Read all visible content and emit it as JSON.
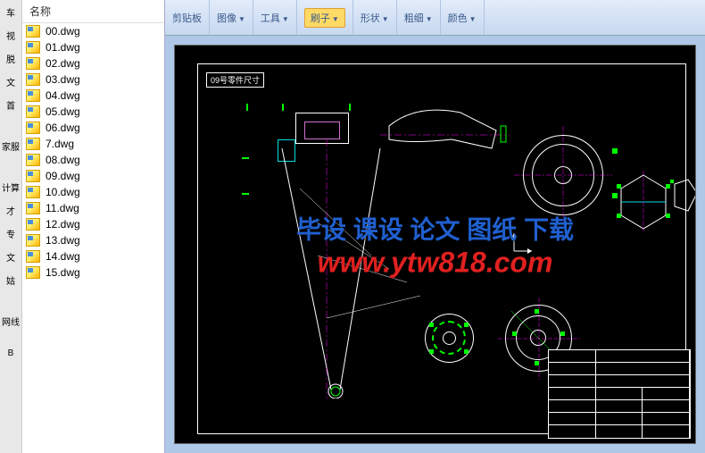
{
  "sidebar_tabs": [
    "车",
    "视",
    "脱",
    "文",
    "首",
    "家服",
    "计算",
    "才",
    "专",
    "文",
    "姑",
    "网线",
    "B"
  ],
  "file_panel": {
    "header": "名称",
    "files": [
      "00.dwg",
      "01.dwg",
      "02.dwg",
      "03.dwg",
      "04.dwg",
      "05.dwg",
      "06.dwg",
      "7.dwg",
      "08.dwg",
      "09.dwg",
      "10.dwg",
      "11.dwg",
      "12.dwg",
      "13.dwg",
      "14.dwg",
      "15.dwg"
    ]
  },
  "ribbon": {
    "clipboard": "剪贴板",
    "image": "图像",
    "tools": "工具",
    "brush": "刷子",
    "shapes": "形状",
    "thickness": "粗细",
    "color": "颜色"
  },
  "cad": {
    "title_label": "09号零件尺寸"
  },
  "watermark": {
    "line1": "毕设 课设 论文 图纸 下载",
    "line2": "www.ytw818.com"
  }
}
